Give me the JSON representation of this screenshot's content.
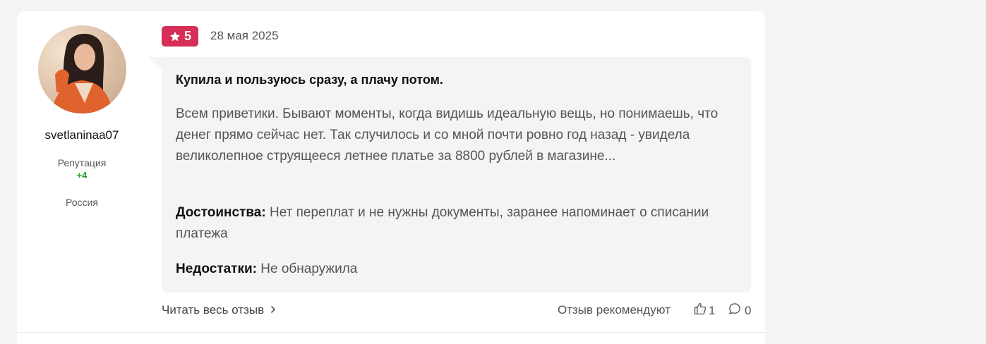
{
  "author": {
    "username": "svetlaninaa07",
    "reputation_label": "Репутация",
    "reputation_value": "+4",
    "country": "Россия"
  },
  "review": {
    "rating": "5",
    "date": "28 мая 2025",
    "title": "Купила и пользуюсь сразу, а плачу потом.",
    "text": "Всем приветики. Бывают моменты, когда видишь идеальную вещь, но понимаешь, что денег прямо сейчас нет. Так случилось и со мной почти ровно год назад - увидела великолепное струящееся летнее платье за 8800 рублей в магазине...",
    "pros_label": "Достоинства:",
    "pros_text": "Нет переплат и не нужны документы, заранее напоминает о списании платежа",
    "cons_label": "Недостатки:",
    "cons_text": "Не обнаружила"
  },
  "footer": {
    "read_more": "Читать весь отзыв",
    "recommend_label": "Отзыв рекомендуют",
    "likes_count": "1",
    "comments_count": "0"
  },
  "colors": {
    "badge": "#d62e56",
    "reputation": "#1aa31a",
    "bubble_bg": "#f4f4f6"
  },
  "icons": {
    "rating": "star-icon",
    "read_more": "chevron-right-icon",
    "likes": "thumbs-up-icon",
    "comments": "comment-icon"
  }
}
